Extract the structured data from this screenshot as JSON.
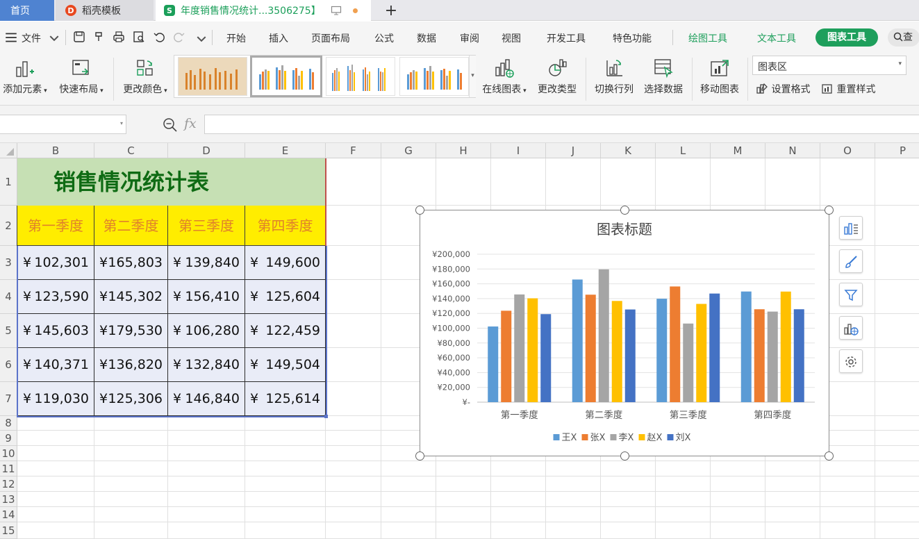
{
  "tabs": {
    "home": "首页",
    "template": "稻壳模板",
    "document": "年度销售情况统计...3506275】"
  },
  "menu": {
    "file": "文件",
    "items": [
      "开始",
      "插入",
      "页面布局",
      "公式",
      "数据",
      "审阅",
      "视图",
      "开发工具",
      "特色功能"
    ],
    "drawing_tools": "绘图工具",
    "text_tools": "文本工具",
    "chart_tools": "图表工具",
    "search": "查"
  },
  "ribbon": {
    "add_element": "添加元素",
    "quick_layout": "快速布局",
    "change_color": "更改颜色",
    "online_chart": "在线图表",
    "change_type": "更改类型",
    "switch_row_col": "切换行列",
    "select_data": "选择数据",
    "move_chart": "移动图表",
    "chart_area": "图表区",
    "set_format": "设置格式",
    "reset_style": "重置样式"
  },
  "formula": {
    "fx": "fx"
  },
  "grid": {
    "columns": [
      "B",
      "C",
      "D",
      "E",
      "F",
      "G",
      "H",
      "I",
      "J",
      "K",
      "L",
      "M",
      "N",
      "O",
      "P"
    ],
    "rows": [
      "1",
      "2",
      "3",
      "4",
      "5",
      "6",
      "7",
      "8",
      "9",
      "10",
      "11",
      "12",
      "13",
      "14",
      "15"
    ]
  },
  "table": {
    "title": "销售情况统计表",
    "headers": [
      "第一季度",
      "第二季度",
      "第三季度",
      "第四季度"
    ],
    "currency": "¥",
    "rows": [
      [
        "102,301",
        "165,803",
        "139,840",
        "149,600"
      ],
      [
        "123,590",
        "145,302",
        "156,410",
        "125,604"
      ],
      [
        "145,603",
        "179,530",
        "106,280",
        "122,459"
      ],
      [
        "140,371",
        "136,820",
        "132,840",
        "149,504"
      ],
      [
        "119,030",
        "125,306",
        "146,840",
        "125,614"
      ]
    ]
  },
  "chart_data": {
    "type": "bar",
    "title": "图表标题",
    "categories": [
      "第一季度",
      "第二季度",
      "第三季度",
      "第四季度"
    ],
    "series": [
      {
        "name": "王X",
        "color": "#5b9bd5",
        "values": [
          102301,
          165803,
          139840,
          149600
        ]
      },
      {
        "name": "张X",
        "color": "#ed7d31",
        "values": [
          123590,
          145302,
          156410,
          125604
        ]
      },
      {
        "name": "李X",
        "color": "#a5a5a5",
        "values": [
          145603,
          179530,
          106280,
          122459
        ]
      },
      {
        "name": "赵X",
        "color": "#ffc000",
        "values": [
          140371,
          136820,
          132840,
          149504
        ]
      },
      {
        "name": "刘X",
        "color": "#4472c4",
        "values": [
          119030,
          125306,
          146840,
          125614
        ]
      }
    ],
    "y_ticks": [
      "¥200,000",
      "¥180,000",
      "¥160,000",
      "¥140,000",
      "¥120,000",
      "¥100,000",
      "¥80,000",
      "¥60,000",
      "¥40,000",
      "¥20,000",
      "¥-"
    ],
    "ylim": [
      0,
      200000
    ],
    "legend": "bottom",
    "grid": true
  }
}
